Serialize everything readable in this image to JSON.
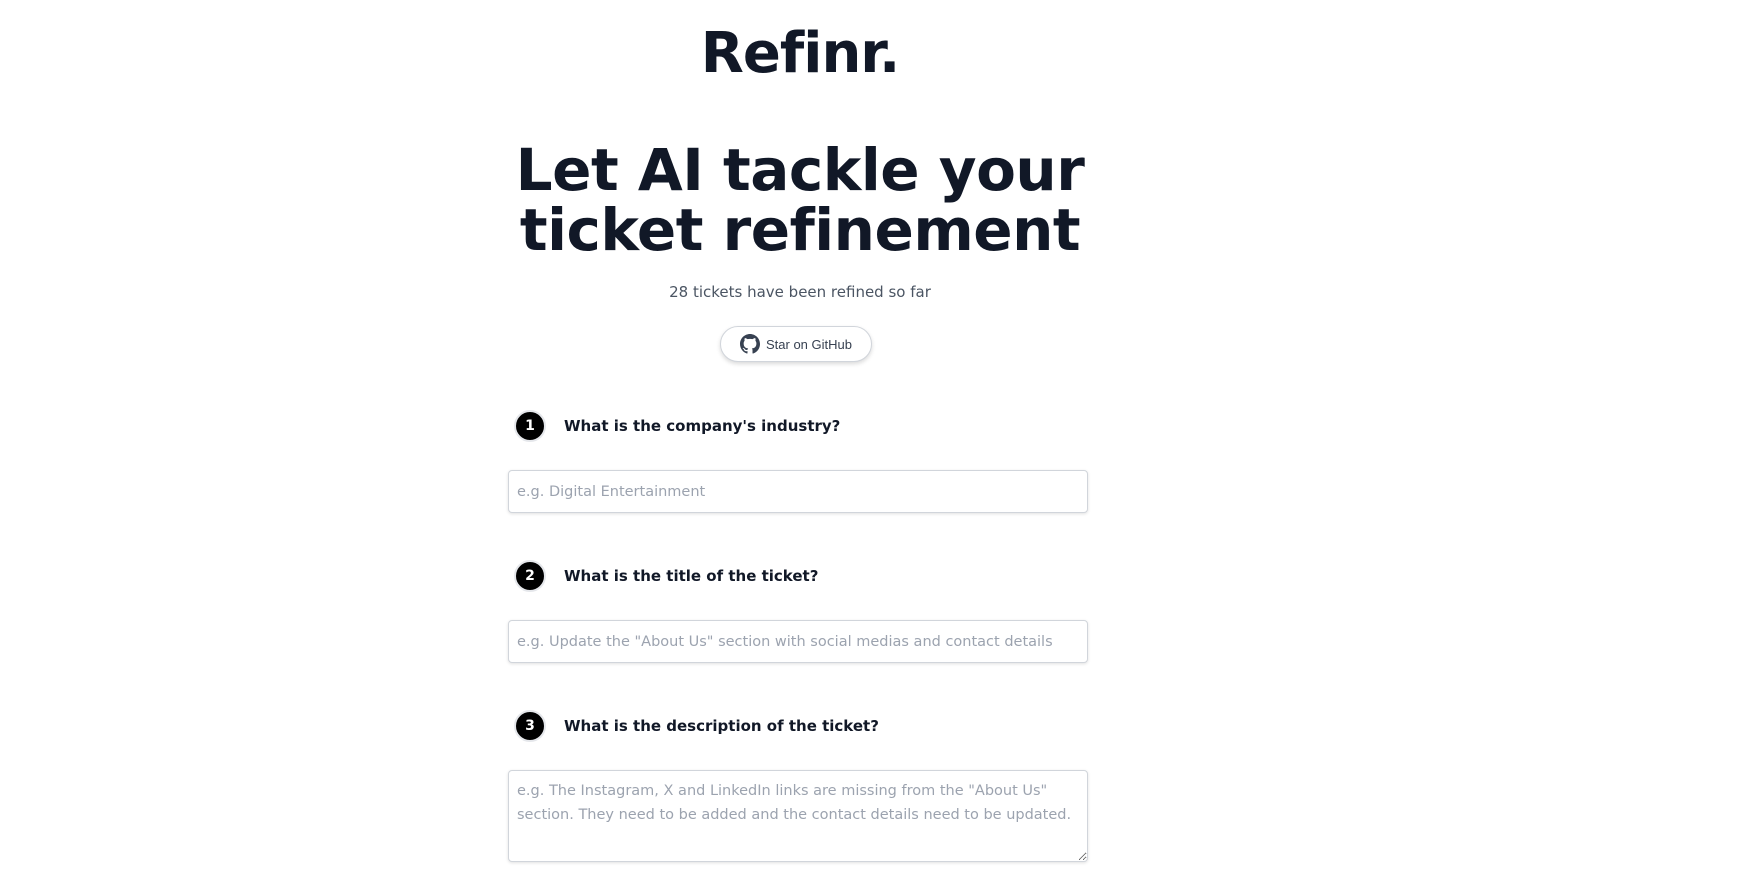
{
  "brand": {
    "logo_text": "Refinr."
  },
  "hero": {
    "headline": "Let AI tackle your ticket refinement",
    "counter_text": "28 tickets have been refined so far"
  },
  "github_button": {
    "icon": "github-icon",
    "label": "Star on GitHub"
  },
  "form": {
    "steps": [
      {
        "number": "1",
        "question": "What is the company's industry?",
        "placeholder": "e.g. Digital Entertainment",
        "value": ""
      },
      {
        "number": "2",
        "question": "What is the title of the ticket?",
        "placeholder": "e.g. Update the \"About Us\" section with social medias and contact details",
        "value": ""
      },
      {
        "number": "3",
        "question": "What is the description of the ticket?",
        "placeholder": "e.g. The Instagram, X and LinkedIn links are missing from the \"About Us\" section. They need to be added and the contact details need to be updated.",
        "value": ""
      }
    ]
  },
  "colors": {
    "text_primary": "#111827",
    "text_muted": "#4b5563",
    "badge_bg": "#000000",
    "border": "#d1d5db",
    "placeholder": "#9ca3af"
  }
}
